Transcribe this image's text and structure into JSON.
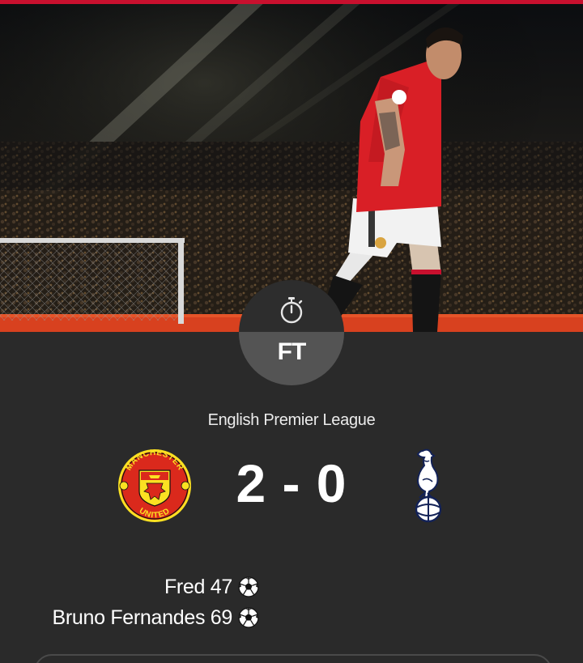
{
  "colors": {
    "accent": "#c8102e",
    "panel_background": "#2a2a2a",
    "dial_bottom": "#545454",
    "dial_top": "#2d2d2d",
    "text": "#ffffff",
    "home_crest_red": "#da291c",
    "home_crest_gold": "#fbe122",
    "away_crest_navy": "#132257"
  },
  "hero": {
    "image": "photo-of-red-kit-player-walking-in-stadium"
  },
  "match": {
    "status": "FT",
    "status_icon": "stopwatch-icon",
    "competition": "English Premier League",
    "home_team": {
      "crest": "manchester-united-crest-icon",
      "crest_text_top": "MANCHESTER",
      "crest_text_bottom": "UNITED"
    },
    "away_team": {
      "crest": "tottenham-hotspur-crest-icon"
    },
    "score": "2 - 0"
  },
  "goals": [
    {
      "text": "Fred 47",
      "icon": "football-icon"
    },
    {
      "text": "Bruno Fernandes 69",
      "icon": "football-icon"
    }
  ]
}
